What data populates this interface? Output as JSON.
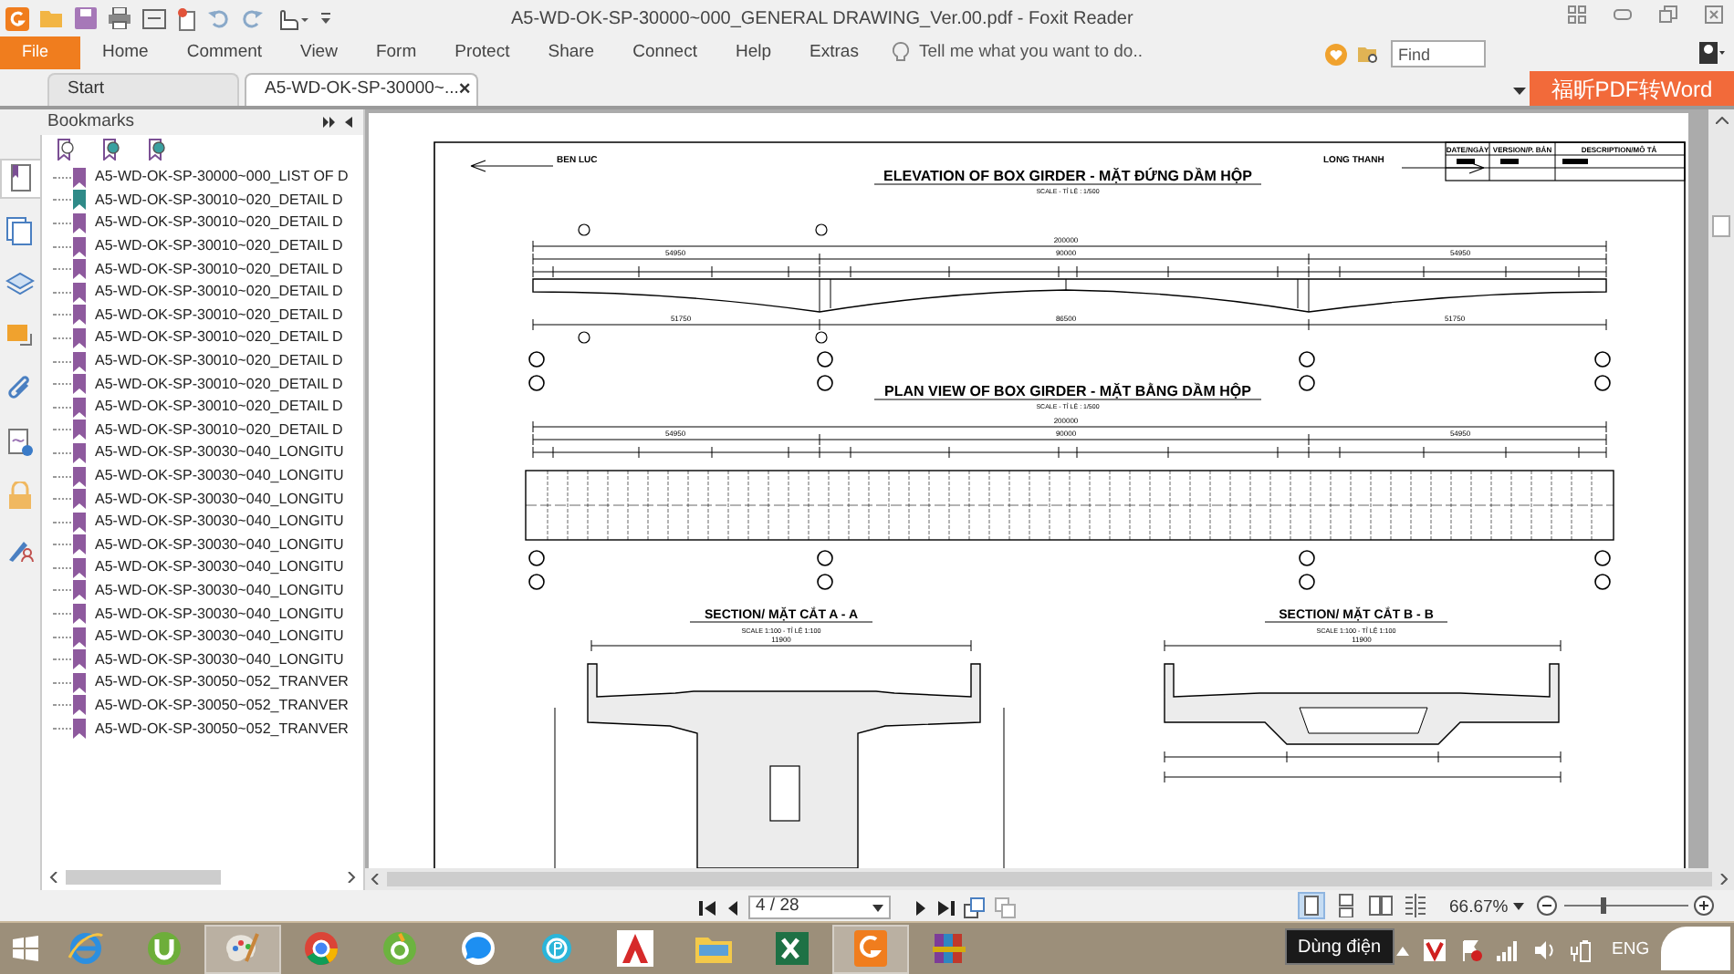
{
  "window": {
    "title": "A5-WD-OK-SP-30000~000_GENERAL DRAWING_Ver.00.pdf - Foxit Reader"
  },
  "ribbon": {
    "file": "File",
    "menus": [
      "Home",
      "Comment",
      "View",
      "Form",
      "Protect",
      "Share",
      "Connect",
      "Help",
      "Extras"
    ],
    "tell_me": {
      "placeholder": "Tell me what you want to do.."
    },
    "find": {
      "placeholder": "Find"
    }
  },
  "tabs": [
    {
      "label": "Start",
      "selected": false
    },
    {
      "label": "A5-WD-OK-SP-30000~...",
      "selected": true,
      "close": "×"
    }
  ],
  "promo_button": "福昕PDF转Word",
  "side_tabs": [
    {
      "kind": "bookmarks",
      "selected": true
    },
    {
      "kind": "pages",
      "selected": false
    },
    {
      "kind": "layers",
      "selected": false
    },
    {
      "kind": "comments",
      "selected": false
    },
    {
      "kind": "attachments",
      "selected": false
    },
    {
      "kind": "signature",
      "selected": false
    },
    {
      "kind": "security",
      "selected": false
    },
    {
      "kind": "sign",
      "selected": false
    }
  ],
  "sidebar": {
    "title": "Bookmarks",
    "items": [
      {
        "label": "A5-WD-OK-SP-30000~000_LIST OF D",
        "color": "#8e5a9e"
      },
      {
        "label": "A5-WD-OK-SP-30010~020_DETAIL D",
        "color": "#2f8a88"
      },
      {
        "label": "A5-WD-OK-SP-30010~020_DETAIL D",
        "color": "#8e5a9e"
      },
      {
        "label": "A5-WD-OK-SP-30010~020_DETAIL D",
        "color": "#8e5a9e"
      },
      {
        "label": "A5-WD-OK-SP-30010~020_DETAIL D",
        "color": "#8e5a9e"
      },
      {
        "label": "A5-WD-OK-SP-30010~020_DETAIL D",
        "color": "#8e5a9e"
      },
      {
        "label": "A5-WD-OK-SP-30010~020_DETAIL D",
        "color": "#8e5a9e"
      },
      {
        "label": "A5-WD-OK-SP-30010~020_DETAIL D",
        "color": "#8e5a9e"
      },
      {
        "label": "A5-WD-OK-SP-30010~020_DETAIL D",
        "color": "#8e5a9e"
      },
      {
        "label": "A5-WD-OK-SP-30010~020_DETAIL D",
        "color": "#8e5a9e"
      },
      {
        "label": "A5-WD-OK-SP-30010~020_DETAIL D",
        "color": "#8e5a9e"
      },
      {
        "label": "A5-WD-OK-SP-30010~020_DETAIL D",
        "color": "#8e5a9e"
      },
      {
        "label": "A5-WD-OK-SP-30030~040_LONGITU",
        "color": "#8e5a9e"
      },
      {
        "label": "A5-WD-OK-SP-30030~040_LONGITU",
        "color": "#8e5a9e"
      },
      {
        "label": "A5-WD-OK-SP-30030~040_LONGITU",
        "color": "#8e5a9e"
      },
      {
        "label": "A5-WD-OK-SP-30030~040_LONGITU",
        "color": "#8e5a9e"
      },
      {
        "label": "A5-WD-OK-SP-30030~040_LONGITU",
        "color": "#8e5a9e"
      },
      {
        "label": "A5-WD-OK-SP-30030~040_LONGITU",
        "color": "#8e5a9e"
      },
      {
        "label": "A5-WD-OK-SP-30030~040_LONGITU",
        "color": "#8e5a9e"
      },
      {
        "label": "A5-WD-OK-SP-30030~040_LONGITU",
        "color": "#8e5a9e"
      },
      {
        "label": "A5-WD-OK-SP-30030~040_LONGITU",
        "color": "#8e5a9e"
      },
      {
        "label": "A5-WD-OK-SP-30030~040_LONGITU",
        "color": "#8e5a9e"
      },
      {
        "label": "A5-WD-OK-SP-30050~052_TRANVER",
        "color": "#8e5a9e"
      },
      {
        "label": "A5-WD-OK-SP-30050~052_TRANVER",
        "color": "#8e5a9e"
      },
      {
        "label": "A5-WD-OK-SP-30050~052_TRANVER",
        "color": "#8e5a9e"
      }
    ]
  },
  "document": {
    "header_left": "BEN LUC",
    "header_right": "LONG THANH",
    "title_block": [
      "DATE/NGÀY",
      "VERSION/P. BẢN",
      "DESCRIPTION/MÔ TẢ"
    ],
    "views": [
      {
        "kind": "elevation",
        "title": "ELEVATION OF BOX GIRDER - MẶT ĐỨNG DẦM HỘP",
        "scale": "SCALE - TỈ LỆ : 1/500",
        "overall": "200000",
        "spans": [
          "54950",
          "90000",
          "54950"
        ],
        "lower_spans": [
          "51750",
          "86500",
          "51750"
        ]
      },
      {
        "kind": "plan",
        "title": "PLAN VIEW OF BOX GIRDER - MẶT BẰNG DẦM HỘP",
        "scale": "SCALE - TỈ LỆ : 1/500",
        "overall": "200000",
        "spans": [
          "54950",
          "90000",
          "54950"
        ]
      },
      {
        "kind": "section_a",
        "title": "SECTION/ MẶT CẮT A - A",
        "scale": "SCALE 1:100 - TỈ LỆ 1:100",
        "overall": "11900"
      },
      {
        "kind": "section_b",
        "title": "SECTION/ MẶT CẮT B - B",
        "scale": "SCALE 1:100 - TỈ LỆ 1:100",
        "overall": "11900"
      }
    ]
  },
  "navigation": {
    "page": "4 / 28",
    "zoom": "66.67%",
    "zoom_slider": {
      "level": 0.3
    },
    "view_modes": [
      {
        "kind": "single",
        "selected": true
      },
      {
        "kind": "continuous",
        "selected": false
      },
      {
        "kind": "facing",
        "selected": false
      },
      {
        "kind": "continuous_facing",
        "selected": false
      }
    ]
  },
  "taskbar": {
    "apps": [
      {
        "kind": "ie",
        "selected": false
      },
      {
        "kind": "torrent",
        "selected": false
      },
      {
        "kind": "paint",
        "selected": true
      },
      {
        "kind": "chrome",
        "selected": false
      },
      {
        "kind": "coccoc",
        "selected": false
      },
      {
        "kind": "zalo",
        "selected": false
      },
      {
        "kind": "p_app",
        "selected": false
      },
      {
        "kind": "cad",
        "selected": false
      },
      {
        "kind": "explorer",
        "selected": false
      },
      {
        "kind": "excel",
        "selected": false
      },
      {
        "kind": "foxit",
        "selected": true
      },
      {
        "kind": "archive",
        "selected": false
      }
    ],
    "tooltip": "Dùng điện",
    "language": "ENG"
  }
}
